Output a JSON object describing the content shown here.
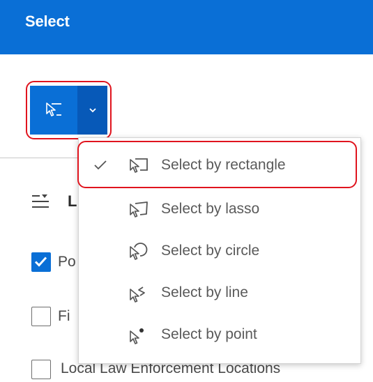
{
  "header": {
    "title": "Select"
  },
  "tool_button": {
    "icon": "select-rectangle-icon",
    "dropdown_icon": "chevron-down-icon"
  },
  "menu": {
    "items": [
      {
        "label": "Select by rectangle",
        "icon": "select-rectangle-icon",
        "selected": true
      },
      {
        "label": "Select by lasso",
        "icon": "select-lasso-icon",
        "selected": false
      },
      {
        "label": "Select by circle",
        "icon": "select-circle-icon",
        "selected": false
      },
      {
        "label": "Select by line",
        "icon": "select-line-icon",
        "selected": false
      },
      {
        "label": "Select by point",
        "icon": "select-point-icon",
        "selected": false
      }
    ]
  },
  "layers": {
    "heading_partial": "L",
    "items": [
      {
        "label_partial": "Po",
        "checked": true
      },
      {
        "label_partial": "Fi",
        "checked": false
      },
      {
        "label": "Local Law Enforcement Locations",
        "checked": false
      }
    ]
  },
  "colors": {
    "primary": "#0a6fd6",
    "primary_dark": "#0759b8",
    "highlight": "#e0141e"
  }
}
